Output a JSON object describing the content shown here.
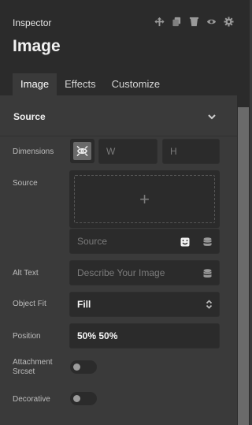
{
  "header": {
    "title": "Inspector",
    "heading": "Image",
    "icons": [
      "move-icon",
      "copy-icon",
      "delete-icon",
      "eye-icon",
      "gear-icon"
    ]
  },
  "tabs": [
    {
      "label": "Image",
      "active": true
    },
    {
      "label": "Effects",
      "active": false
    },
    {
      "label": "Customize",
      "active": false
    }
  ],
  "section": {
    "title": "Source",
    "expanded": true
  },
  "fields": {
    "dimensions": {
      "label": "Dimensions",
      "width_placeholder": "W",
      "height_placeholder": "H"
    },
    "source": {
      "label": "Source",
      "add_symbol": "+",
      "placeholder": "Source"
    },
    "alt_text": {
      "label": "Alt Text",
      "placeholder": "Describe Your Image"
    },
    "object_fit": {
      "label": "Object Fit",
      "value": "Fill"
    },
    "position": {
      "label": "Position",
      "value": "50% 50%"
    },
    "attachment_srcset": {
      "label_line1": "Attachment",
      "label_line2": "Srcset",
      "enabled": false
    },
    "decorative": {
      "label": "Decorative",
      "enabled": false
    }
  },
  "colors": {
    "panel": "#3a3a3a",
    "header": "#2b2b2b",
    "field": "#2b2b2b"
  }
}
